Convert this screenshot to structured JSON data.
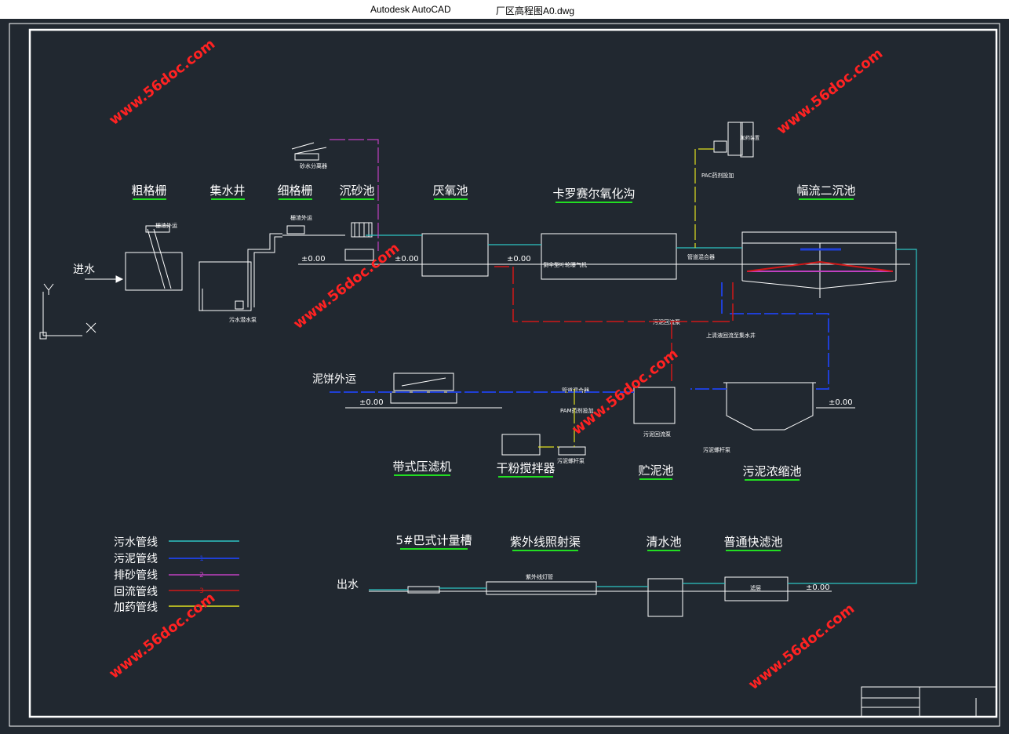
{
  "window": {
    "app_name": "Autodesk AutoCAD",
    "file_name": "厂区高程图A0.dwg"
  },
  "colors": {
    "background": "#212830",
    "sewage": "#2ec4c4",
    "sludge": "#1f3fd6",
    "sand": "#c040c0",
    "return": "#d01818",
    "dosing": "#e0e020",
    "title": "#ffffff",
    "underline": "#22dd22",
    "watermark": "#ff2222"
  },
  "units": {
    "coarse_screen": "粗格栅",
    "sump": "集水井",
    "fine_screen": "细格栅",
    "grit_chamber": "沉砂池",
    "anaerobic_tank": "厌氧池",
    "carrousel_ditch": "卡罗赛尔氧化沟",
    "secondary_clarifier": "幅流二沉池",
    "belt_filter_press": "带式压滤机",
    "dry_powder_mixer": "干粉搅拌器",
    "sludge_storage": "贮泥池",
    "sludge_thickener": "污泥浓缩池",
    "parshall_flume": "5#巴式计量槽",
    "uv_channel": "紫外线照射渠",
    "clear_water_tank": "清水池",
    "rapid_filter": "普通快滤池"
  },
  "flow_labels": {
    "inlet": "进水",
    "outlet": "出水",
    "cake_out": "泥饼外运"
  },
  "small_labels": {
    "grille_out": "栅渣外运",
    "grille_out2": "栅渣外运",
    "sand_separator": "砂水分离器",
    "sewage_pump": "污水潜水泵",
    "aerator": "倒伞型叶轮曝气机",
    "pac": "PAC药剂投加",
    "pac_device": "加药装置",
    "mixer1": "管道混合器",
    "mixer2": "管道混合器",
    "return_pump": "污泥回流泵",
    "return_pump2": "污泥回流泵",
    "supernatant": "上清液回流至集水井",
    "pam": "PAM药剂投加",
    "screw_pump1": "污泥螺杆泵",
    "screw_pump2": "污泥螺杆泵",
    "uv_lamp": "紫外线灯管",
    "filter_media": "滤层"
  },
  "levels": {
    "zero": "±0.00"
  },
  "legend": [
    {
      "label": "污水管线",
      "code": "",
      "color": "#2ec4c4"
    },
    {
      "label": "污泥管线",
      "code": "1",
      "color": "#1f3fd6"
    },
    {
      "label": "排砂管线",
      "code": "2",
      "color": "#c040c0"
    },
    {
      "label": "回流管线",
      "code": "3",
      "color": "#d01818"
    },
    {
      "label": "加药管线",
      "code": "",
      "color": "#e0e020"
    }
  ],
  "pipe_codes": {
    "sludge": "1",
    "sand": "2",
    "return": "3",
    "dosing": "4"
  },
  "ucs": {
    "y": "Y",
    "x": "X"
  },
  "watermark": "www.56doc.com"
}
